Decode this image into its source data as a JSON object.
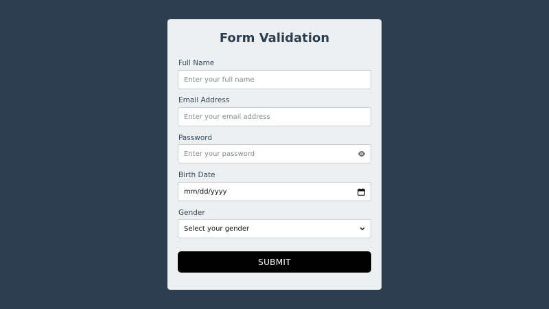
{
  "form": {
    "title": "Form Validation",
    "full_name": {
      "label": "Full Name",
      "placeholder": "Enter your full name",
      "value": ""
    },
    "email": {
      "label": "Email Address",
      "placeholder": "Enter your email address",
      "value": ""
    },
    "password": {
      "label": "Password",
      "placeholder": "Enter your password",
      "value": "",
      "toggle_icon": "eye-icon"
    },
    "birth_date": {
      "label": "Birth Date",
      "value": "mm/dd/yyyy",
      "icon": "calendar-icon"
    },
    "gender": {
      "label": "Gender",
      "selected": "Select your gender",
      "icon": "chevron-down-icon"
    },
    "submit_label": "SUBMIT"
  },
  "colors": {
    "background": "#2c3e50",
    "card": "#ecf0f1",
    "title": "#2c3e50",
    "button": "#000000",
    "button_text": "#ffffff"
  }
}
